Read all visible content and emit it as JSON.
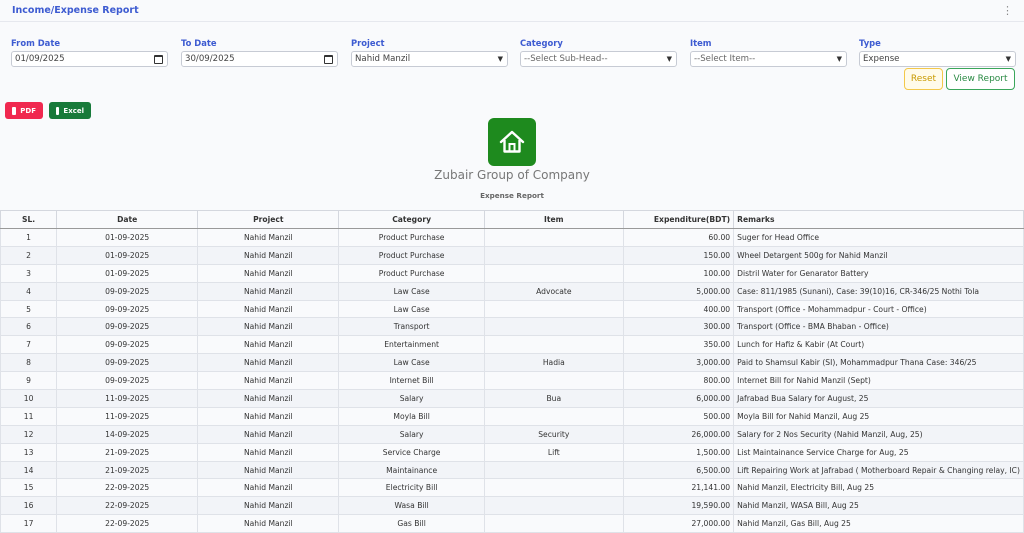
{
  "header": {
    "title": "Income/Expense Report"
  },
  "filters": {
    "from_date": {
      "label": "From Date",
      "value": "01/09/2025"
    },
    "to_date": {
      "label": "To Date",
      "value": "30/09/2025"
    },
    "project": {
      "label": "Project",
      "value": "Nahid Manzil"
    },
    "category": {
      "label": "Category",
      "value": "--Select Sub-Head--"
    },
    "item": {
      "label": "Item",
      "value": "--Select Item--"
    },
    "type": {
      "label": "Type",
      "value": "Expense"
    }
  },
  "buttons": {
    "reset": "Reset",
    "view_report": "View Report",
    "pdf": "PDF",
    "excel": "Excel"
  },
  "brand": {
    "company": "Zubair Group of Company",
    "report_title": "Expense Report"
  },
  "colors": {
    "accent": "#3d5bd1",
    "pdf": "#f0284f",
    "excel": "#187a3a",
    "logo": "#1e8a1e"
  },
  "table": {
    "headers": [
      "SL.",
      "Date",
      "Project",
      "Category",
      "Item",
      "Expenditure(BDT)",
      "Remarks"
    ],
    "rows": [
      [
        "1",
        "01-09-2025",
        "Nahid Manzil",
        "Product Purchase",
        "",
        "60.00",
        "Suger for Head Office"
      ],
      [
        "2",
        "01-09-2025",
        "Nahid Manzil",
        "Product Purchase",
        "",
        "150.00",
        "Wheel Detargent 500g for Nahid Manzil"
      ],
      [
        "3",
        "01-09-2025",
        "Nahid Manzil",
        "Product Purchase",
        "",
        "100.00",
        "Distril Water for Genarator Battery"
      ],
      [
        "4",
        "09-09-2025",
        "Nahid Manzil",
        "Law Case",
        "Advocate",
        "5,000.00",
        "Case: 811/1985 (Sunani), Case: 39(10)16, CR-346/25 Nothi Tola"
      ],
      [
        "5",
        "09-09-2025",
        "Nahid Manzil",
        "Law Case",
        "",
        "400.00",
        "Transport (Office - Mohammadpur - Court - Office)"
      ],
      [
        "6",
        "09-09-2025",
        "Nahid Manzil",
        "Transport",
        "",
        "300.00",
        "Transport (Office - BMA Bhaban - Office)"
      ],
      [
        "7",
        "09-09-2025",
        "Nahid Manzil",
        "Entertainment",
        "",
        "350.00",
        "Lunch for Hafiz & Kabir (At Court)"
      ],
      [
        "8",
        "09-09-2025",
        "Nahid Manzil",
        "Law Case",
        "Hadia",
        "3,000.00",
        "Paid to Shamsul Kabir (SI), Mohammadpur Thana Case: 346/25"
      ],
      [
        "9",
        "09-09-2025",
        "Nahid Manzil",
        "Internet Bill",
        "",
        "800.00",
        "Internet Bill for Nahid Manzil (Sept)"
      ],
      [
        "10",
        "11-09-2025",
        "Nahid Manzil",
        "Salary",
        "Bua",
        "6,000.00",
        "Jafrabad Bua Salary for August, 25"
      ],
      [
        "11",
        "11-09-2025",
        "Nahid Manzil",
        "Moyla Bill",
        "",
        "500.00",
        "Moyla Bill for Nahid Manzil, Aug 25"
      ],
      [
        "12",
        "14-09-2025",
        "Nahid Manzil",
        "Salary",
        "Security",
        "26,000.00",
        "Salary for 2 Nos Security (Nahid Manzil, Aug, 25)"
      ],
      [
        "13",
        "21-09-2025",
        "Nahid Manzil",
        "Service Charge",
        "Lift",
        "1,500.00",
        "List Maintainance Service Charge for Aug, 25"
      ],
      [
        "14",
        "21-09-2025",
        "Nahid Manzil",
        "Maintainance",
        "",
        "6,500.00",
        "Lift Repairing Work at Jafrabad ( Motherboard Repair & Changing relay, IC)"
      ],
      [
        "15",
        "22-09-2025",
        "Nahid Manzil",
        "Electricity Bill",
        "",
        "21,141.00",
        "Nahid Manzil, Electricity Bill, Aug 25"
      ],
      [
        "16",
        "22-09-2025",
        "Nahid Manzil",
        "Wasa Bill",
        "",
        "19,590.00",
        "Nahid Manzil, WASA Bill, Aug 25"
      ],
      [
        "17",
        "22-09-2025",
        "Nahid Manzil",
        "Gas Bill",
        "",
        "27,000.00",
        "Nahid Manzil, Gas Bill, Aug 25"
      ]
    ]
  }
}
